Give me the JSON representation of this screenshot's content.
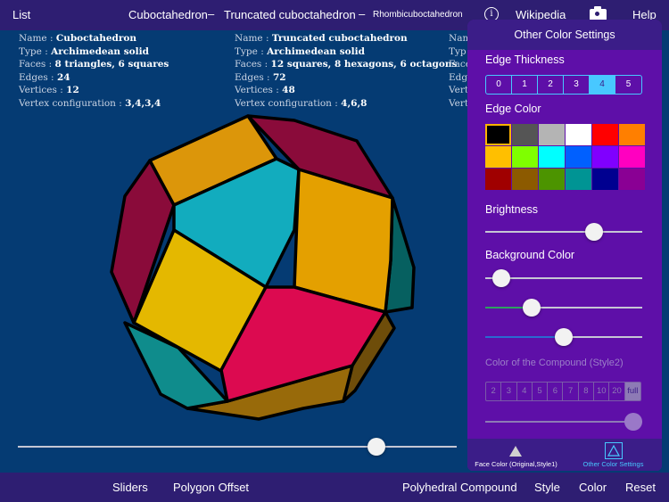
{
  "topbar": {
    "list": "List",
    "tab1": "Cuboctahedron",
    "tab2": "Truncated cuboctahedron",
    "tab3": "Rhombicuboctahedron",
    "dash": "–",
    "info_icon": "info-icon",
    "info_glyph": "i",
    "wikipedia": "Wikipedia",
    "camera_icon": "camera-icon",
    "help": "Help"
  },
  "info": {
    "labels": {
      "name": "Name :",
      "type": "Type :",
      "faces": "Faces :",
      "edges": "Edges :",
      "vertices": "Vertices :",
      "vconf": "Vertex configuration :"
    },
    "left": {
      "name": "Cuboctahedron",
      "type": "Archimedean solid",
      "faces": "8 triangles, 6 squares",
      "edges": "24",
      "vertices": "12",
      "vconf": "3,4,3,4"
    },
    "middle": {
      "name": "Truncated cuboctahedron",
      "type": "Archimedean solid",
      "faces": "12 squares, 8 hexagons, 6 octagons",
      "edges": "72",
      "vertices": "48",
      "vconf": "4,6,8"
    },
    "right_partial": [
      "Nam",
      "Typ",
      "Face",
      "Edg",
      "Vert",
      "Vert"
    ]
  },
  "main_slider": {
    "value": 0.83
  },
  "panel": {
    "title": "Other Color Settings",
    "edge_thickness": {
      "label": "Edge Thickness",
      "options": [
        "0",
        "1",
        "2",
        "3",
        "4",
        "5"
      ],
      "selected": "4"
    },
    "edge_color": {
      "label": "Edge Color",
      "swatches": [
        "#000000",
        "#555555",
        "#b4b4b4",
        "#ffffff",
        "#ff0000",
        "#ff7f00",
        "#ffbf00",
        "#7fff00",
        "#00ffff",
        "#0060ff",
        "#8000ff",
        "#ff00c0",
        "#a00000",
        "#8c5a00",
        "#4c9400",
        "#009494",
        "#000090",
        "#8a0094"
      ],
      "selected_index": 0
    },
    "brightness": {
      "label": "Brightness",
      "value": 0.72
    },
    "background_color": {
      "label": "Background Color",
      "red": 0.05,
      "green": 0.27,
      "blue": 0.5,
      "green_color": "#2ea060",
      "blue_color": "#2a6ad0"
    },
    "compound": {
      "label": "Color of the Compound (Style2)",
      "options": [
        "2",
        "3",
        "4",
        "5",
        "6",
        "7",
        "8",
        "10",
        "20",
        "full"
      ],
      "selected": "full",
      "slider_value": 1.0
    },
    "tabs": {
      "face_color": "Face Color (Original,Style1)",
      "other_color": "Other Color Settings"
    }
  },
  "bottombar": {
    "sliders": "Sliders",
    "polygon_offset": "Polygon Offset",
    "polyhedral_compound": "Polyhedral Compound",
    "style": "Style",
    "color": "Color",
    "reset": "Reset"
  },
  "colors": {
    "background": "#053b73",
    "bar": "#2e1e72",
    "panel": "#5e0fa8",
    "accent": "#48c8ff"
  }
}
